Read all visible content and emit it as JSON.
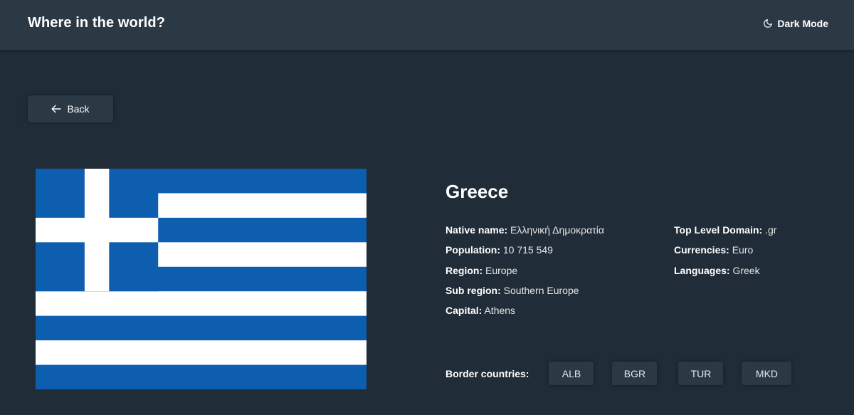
{
  "header": {
    "title": "Where in the world?",
    "mode_label": "Dark Mode",
    "mode_icon": "moon-icon"
  },
  "back": {
    "label": "Back",
    "icon": "arrow-left-icon"
  },
  "flag": {
    "country": "Greece",
    "colors": {
      "blue": "#0d5eaf",
      "white": "#ffffff"
    }
  },
  "country": {
    "name": "Greece",
    "left": [
      {
        "label": "Native name:",
        "value": "Ελληνική Δημοκρατία"
      },
      {
        "label": "Population:",
        "value": "10 715 549"
      },
      {
        "label": "Region:",
        "value": "Europe"
      },
      {
        "label": "Sub region:",
        "value": "Southern Europe"
      },
      {
        "label": "Capital:",
        "value": "Athens"
      }
    ],
    "right": [
      {
        "label": "Top Level Domain:",
        "value": ".gr"
      },
      {
        "label": "Currencies:",
        "value": "Euro"
      },
      {
        "label": "Languages:",
        "value": "Greek"
      }
    ]
  },
  "borders": {
    "label": "Border countries:",
    "items": [
      "ALB",
      "BGR",
      "TUR",
      "MKD"
    ]
  },
  "colors": {
    "background": "#202c37",
    "element": "#2b3945",
    "text": "#ffffff"
  }
}
